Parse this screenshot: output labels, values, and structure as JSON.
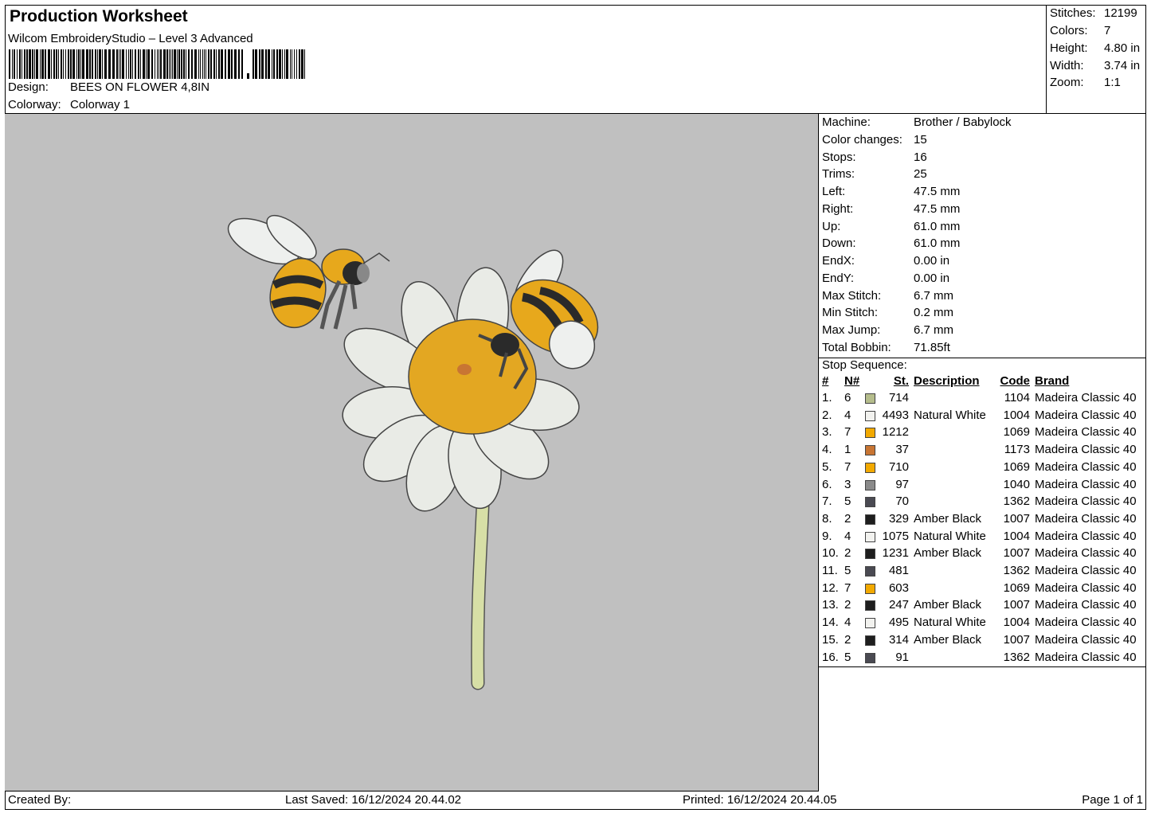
{
  "header": {
    "title": "Production Worksheet",
    "software": "Wilcom EmbroideryStudio – Level 3 Advanced",
    "design_label": "Design:",
    "design_value": "BEES ON FLOWER 4,8IN",
    "colorway_label": "Colorway:",
    "colorway_value": "Colorway 1"
  },
  "stats": [
    {
      "label": "Stitches:",
      "value": "12199"
    },
    {
      "label": "Colors:",
      "value": "7"
    },
    {
      "label": "Height:",
      "value": "4.80 in"
    },
    {
      "label": "Width:",
      "value": "3.74 in"
    },
    {
      "label": "Zoom:",
      "value": "1:1"
    }
  ],
  "info": [
    {
      "label": "Machine:",
      "value": "Brother / Babylock"
    },
    {
      "label": "Color changes:",
      "value": "15"
    },
    {
      "label": "Stops:",
      "value": "16"
    },
    {
      "label": "Trims:",
      "value": "25"
    },
    {
      "label": "Left:",
      "value": "47.5 mm"
    },
    {
      "label": "Right:",
      "value": "47.5 mm"
    },
    {
      "label": "Up:",
      "value": "61.0 mm"
    },
    {
      "label": "Down:",
      "value": "61.0 mm"
    },
    {
      "label": "EndX:",
      "value": "0.00 in"
    },
    {
      "label": "EndY:",
      "value": "0.00 in"
    },
    {
      "label": "Max Stitch:",
      "value": "6.7 mm"
    },
    {
      "label": "Min Stitch:",
      "value": "0.2 mm"
    },
    {
      "label": "Max Jump:",
      "value": "6.7 mm"
    },
    {
      "label": "Total Bobbin:",
      "value": "71.85ft"
    }
  ],
  "sequence": {
    "title": "Stop Sequence:",
    "headers": {
      "num": "#",
      "n": "N#",
      "st": "St.",
      "desc": "Description",
      "code": "Code",
      "brand": "Brand"
    },
    "rows": [
      {
        "num": "1.",
        "n": "6",
        "color": "#b5bd8c",
        "st": "714",
        "desc": "",
        "code": "1104",
        "brand": "Madeira Classic 40"
      },
      {
        "num": "2.",
        "n": "4",
        "color": "#f2f2ef",
        "st": "4493",
        "desc": "Natural White",
        "code": "1004",
        "brand": "Madeira Classic 40"
      },
      {
        "num": "3.",
        "n": "7",
        "color": "#f2a900",
        "st": "1212",
        "desc": "",
        "code": "1069",
        "brand": "Madeira Classic 40"
      },
      {
        "num": "4.",
        "n": "1",
        "color": "#c87533",
        "st": "37",
        "desc": "",
        "code": "1173",
        "brand": "Madeira Classic 40"
      },
      {
        "num": "5.",
        "n": "7",
        "color": "#f2a900",
        "st": "710",
        "desc": "",
        "code": "1069",
        "brand": "Madeira Classic 40"
      },
      {
        "num": "6.",
        "n": "3",
        "color": "#8a8a8a",
        "st": "97",
        "desc": "",
        "code": "1040",
        "brand": "Madeira Classic 40"
      },
      {
        "num": "7.",
        "n": "5",
        "color": "#4a4a52",
        "st": "70",
        "desc": "",
        "code": "1362",
        "brand": "Madeira Classic 40"
      },
      {
        "num": "8.",
        "n": "2",
        "color": "#1e1e1e",
        "st": "329",
        "desc": "Amber Black",
        "code": "1007",
        "brand": "Madeira Classic 40"
      },
      {
        "num": "9.",
        "n": "4",
        "color": "#f2f2ef",
        "st": "1075",
        "desc": "Natural White",
        "code": "1004",
        "brand": "Madeira Classic 40"
      },
      {
        "num": "10.",
        "n": "2",
        "color": "#1e1e1e",
        "st": "1231",
        "desc": "Amber Black",
        "code": "1007",
        "brand": "Madeira Classic 40"
      },
      {
        "num": "11.",
        "n": "5",
        "color": "#4a4a52",
        "st": "481",
        "desc": "",
        "code": "1362",
        "brand": "Madeira Classic 40"
      },
      {
        "num": "12.",
        "n": "7",
        "color": "#f2a900",
        "st": "603",
        "desc": "",
        "code": "1069",
        "brand": "Madeira Classic 40"
      },
      {
        "num": "13.",
        "n": "2",
        "color": "#1e1e1e",
        "st": "247",
        "desc": "Amber Black",
        "code": "1007",
        "brand": "Madeira Classic 40"
      },
      {
        "num": "14.",
        "n": "4",
        "color": "#f2f2ef",
        "st": "495",
        "desc": "Natural White",
        "code": "1004",
        "brand": "Madeira Classic 40"
      },
      {
        "num": "15.",
        "n": "2",
        "color": "#1e1e1e",
        "st": "314",
        "desc": "Amber Black",
        "code": "1007",
        "brand": "Madeira Classic 40"
      },
      {
        "num": "16.",
        "n": "5",
        "color": "#4a4a52",
        "st": "91",
        "desc": "",
        "code": "1362",
        "brand": "Madeira Classic 40"
      }
    ]
  },
  "footer": {
    "created_by": "Created By:",
    "last_saved": "Last Saved: 16/12/2024 20.44.02",
    "printed": "Printed: 16/12/2024 20.44.05",
    "page": "Page 1 of 1"
  },
  "colors": {
    "canvas_bg": "#c0c0c0",
    "petal": "#e9ebe6",
    "center": "#e3a722",
    "stem": "#d7dfa6",
    "bee_yellow": "#e7a81c",
    "bee_black": "#2a2a2a"
  }
}
